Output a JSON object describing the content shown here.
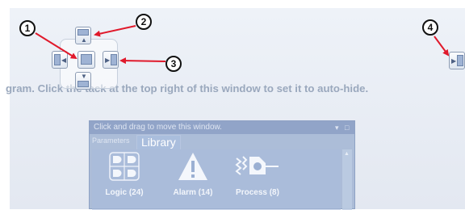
{
  "hint_text": "gram. Click the tack at the top right of this window to set it to auto-hide.",
  "callouts": [
    "1",
    "2",
    "3",
    "4"
  ],
  "dock_icons": {
    "top": "dock-top-icon",
    "left": "dock-left-icon",
    "center": "dock-tabbed-icon",
    "right": "dock-right-icon",
    "bottom": "dock-bottom-icon",
    "far_right": "dock-far-right-icon"
  },
  "library_window": {
    "title": "Click and drag to move this window.",
    "tabs": [
      "Parameters",
      "Library"
    ],
    "items": [
      {
        "label": "Logic (24)",
        "icon": "logic-icon"
      },
      {
        "label": "Alarm (14)",
        "icon": "alarm-icon"
      },
      {
        "label": "Process (8)",
        "icon": "process-icon"
      }
    ]
  },
  "colors": {
    "arrow": "#e0192b",
    "hint": "#9aa8bd",
    "library_bg": "#96aacd"
  }
}
